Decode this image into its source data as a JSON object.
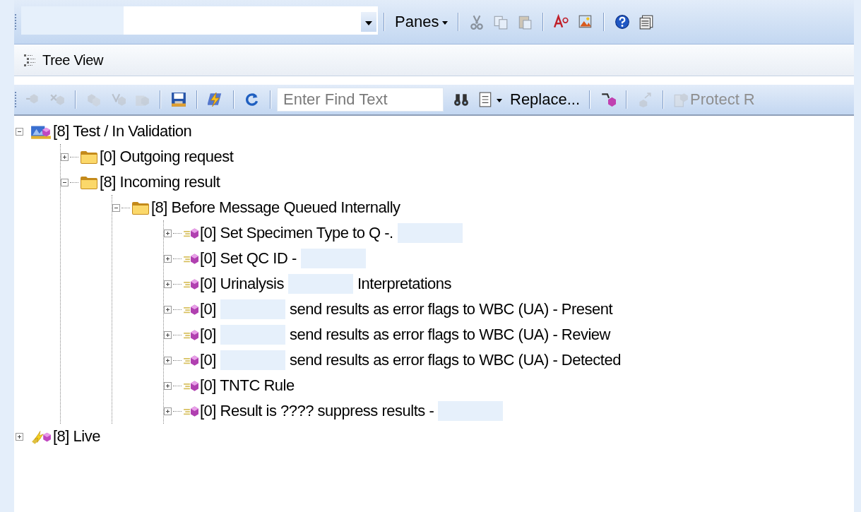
{
  "toolbar": {
    "combo": {
      "parts": [
        {
          "kind": "redacted"
        }
      ]
    },
    "items": [
      {
        "kind": "sep"
      },
      {
        "kind": "menu",
        "label": "Panes"
      },
      {
        "kind": "sep"
      },
      {
        "kind": "icon",
        "disabled": true
      },
      {
        "kind": "icon",
        "disabled": true
      },
      {
        "kind": "icon",
        "disabled": true
      },
      {
        "kind": "sep"
      },
      {
        "kind": "icon",
        "disabled": false
      },
      {
        "kind": "icon",
        "disabled": false
      },
      {
        "kind": "sep"
      },
      {
        "kind": "icon",
        "disabled": false
      },
      {
        "kind": "icon",
        "disabled": false
      }
    ]
  },
  "view_bar": {
    "label": "Tree View"
  },
  "tree_toolbar": {
    "items": [
      {
        "kind": "icon",
        "disabled": true
      },
      {
        "kind": "icon",
        "disabled": true
      },
      {
        "kind": "sep"
      },
      {
        "kind": "icon",
        "disabled": true
      },
      {
        "kind": "icon",
        "disabled": true
      },
      {
        "kind": "icon",
        "disabled": true
      },
      {
        "kind": "sep"
      },
      {
        "kind": "icon",
        "disabled": false
      },
      {
        "kind": "sep"
      },
      {
        "kind": "icon",
        "disabled": false
      },
      {
        "kind": "sep"
      },
      {
        "kind": "icon",
        "disabled": false
      },
      {
        "kind": "sep"
      },
      {
        "kind": "find",
        "placeholder": "Enter Find Text"
      },
      {
        "kind": "icon",
        "disabled": false
      },
      {
        "kind": "menuicon",
        "disabled": false
      },
      {
        "kind": "button",
        "label": "Replace...",
        "disabled": false
      },
      {
        "kind": "sep"
      },
      {
        "kind": "icon",
        "disabled": false
      },
      {
        "kind": "sep"
      },
      {
        "kind": "icon",
        "disabled": true
      },
      {
        "kind": "sep"
      },
      {
        "kind": "iconbutton",
        "label": "Protect R",
        "disabled": true
      }
    ]
  },
  "tree": [
    {
      "kind": "test",
      "expanded": true,
      "parts": [
        {
          "kind": "text",
          "text": "[8] Test / In Validation"
        }
      ],
      "children": [
        {
          "kind": "folder",
          "expanded": false,
          "parts": [
            {
              "kind": "text",
              "text": "[0] Outgoing request"
            }
          ]
        },
        {
          "kind": "folder",
          "expanded": true,
          "parts": [
            {
              "kind": "text",
              "text": "[8] Incoming result"
            }
          ],
          "children": [
            {
              "kind": "folder",
              "expanded": true,
              "parts": [
                {
                  "kind": "text",
                  "text": "[8] Before Message Queued Internally"
                }
              ],
              "children": [
                {
                  "kind": "rule",
                  "expanded": false,
                  "parts": [
                    {
                      "kind": "text",
                      "text": "[0] Set Specimen Type to Q -."
                    },
                    {
                      "kind": "redacted"
                    }
                  ]
                },
                {
                  "kind": "rule",
                  "expanded": false,
                  "parts": [
                    {
                      "kind": "text",
                      "text": "[0] Set QC ID -"
                    },
                    {
                      "kind": "redacted"
                    }
                  ]
                },
                {
                  "kind": "rule",
                  "expanded": false,
                  "parts": [
                    {
                      "kind": "text",
                      "text": "[0] Urinalysis"
                    },
                    {
                      "kind": "redacted"
                    },
                    {
                      "kind": "text",
                      "text": "Interpretations"
                    }
                  ]
                },
                {
                  "kind": "rule",
                  "expanded": false,
                  "parts": [
                    {
                      "kind": "text",
                      "text": "[0]"
                    },
                    {
                      "kind": "redacted"
                    },
                    {
                      "kind": "text",
                      "text": "send results as error flags to WBC (UA) - Present"
                    }
                  ]
                },
                {
                  "kind": "rule",
                  "expanded": false,
                  "parts": [
                    {
                      "kind": "text",
                      "text": "[0]"
                    },
                    {
                      "kind": "redacted"
                    },
                    {
                      "kind": "text",
                      "text": "send results as error flags to WBC (UA) - Review"
                    }
                  ]
                },
                {
                  "kind": "rule",
                  "expanded": false,
                  "parts": [
                    {
                      "kind": "text",
                      "text": "[0]"
                    },
                    {
                      "kind": "redacted"
                    },
                    {
                      "kind": "text",
                      "text": "send results as error flags to WBC (UA) - Detected"
                    }
                  ]
                },
                {
                  "kind": "rule",
                  "expanded": false,
                  "parts": [
                    {
                      "kind": "text",
                      "text": "[0] TNTC Rule"
                    }
                  ]
                },
                {
                  "kind": "rule",
                  "expanded": false,
                  "parts": [
                    {
                      "kind": "text",
                      "text": "[0] Result is ???? suppress results -"
                    },
                    {
                      "kind": "redacted"
                    }
                  ]
                }
              ]
            }
          ]
        }
      ]
    },
    {
      "kind": "live",
      "expanded": false,
      "parts": [
        {
          "kind": "text",
          "text": "[8] Live"
        }
      ]
    }
  ]
}
